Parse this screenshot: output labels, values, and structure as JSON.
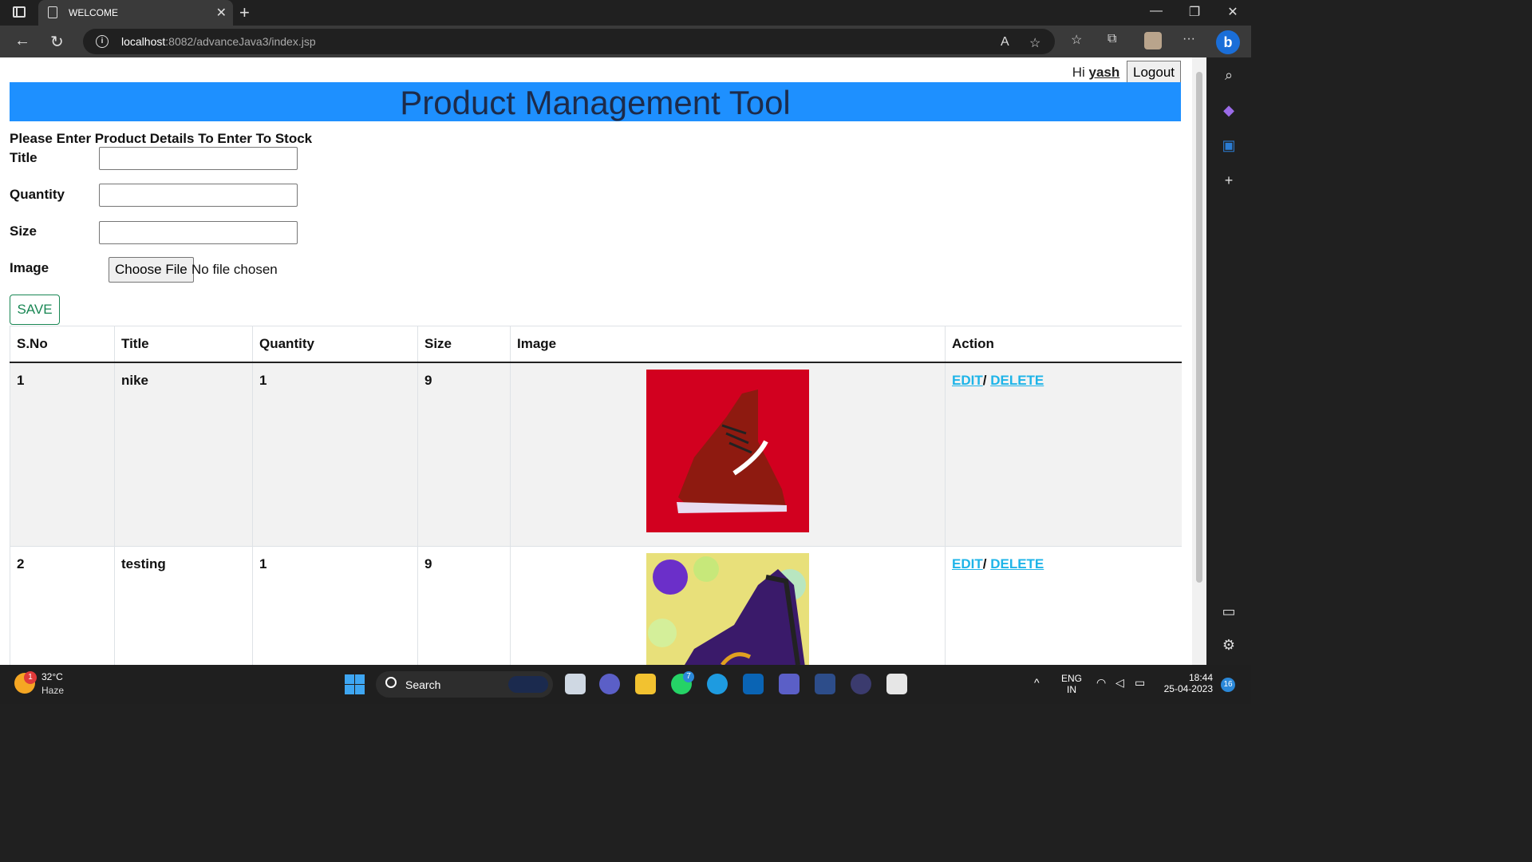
{
  "browser": {
    "tab_title": "WELCOME",
    "url_host": "localhost",
    "url_path": ":8082/advanceJava3/index.jsp"
  },
  "header": {
    "greeting": "Hi",
    "username": "yash",
    "logout_label": "Logout",
    "banner_title": "Product Management Tool"
  },
  "form": {
    "heading": "Please Enter Product Details To Enter To Stock",
    "title_label": "Title",
    "quantity_label": "Quantity",
    "size_label": "Size",
    "image_label": "Image",
    "choose_file_label": "Choose File",
    "no_file_text": "No file chosen",
    "save_label": "SAVE"
  },
  "table": {
    "headers": [
      "S.No",
      "Title",
      "Quantity",
      "Size",
      "Image",
      "Action"
    ],
    "rows": [
      {
        "sno": "1",
        "title": "nike",
        "quantity": "1",
        "size": "9",
        "edit": "EDIT",
        "sep": "/",
        "delete": "DELETE"
      },
      {
        "sno": "2",
        "title": "testing",
        "quantity": "1",
        "size": "9",
        "edit": "EDIT",
        "sep": "/",
        "delete": "DELETE"
      }
    ]
  },
  "taskbar": {
    "weather_badge": "1",
    "temperature": "32°C",
    "weather": "Haze",
    "search_placeholder": "Search",
    "whatsapp_badge": "7",
    "lang_top": "ENG",
    "lang_bottom": "IN",
    "time": "18:44",
    "date": "25-04-2023",
    "notification_count": "16"
  },
  "colors": {
    "banner": "#1e90ff",
    "save_button": "#198754",
    "action_link": "#1eb4e8"
  }
}
